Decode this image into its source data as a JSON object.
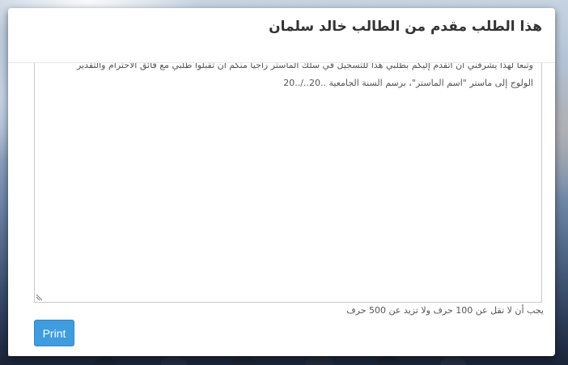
{
  "modal": {
    "title": "هذا الطلب مقدم من الطالب خالد سلمان"
  },
  "letter": {
    "line_partial": "وتبعا لهذا يشرفني أن أتقدم إليكم بطلبي هذا للتسجيل في سلك الماستر راجيا منكم أن تقبلوا طلبي مع فائق الاحترام والتقدير",
    "line_last": "الولوج إلى ماستر \"اسم الماستر\"، برسم السنة الجامعية ..20../..20"
  },
  "form": {
    "help_text": "يجب أن لا تقل عن 100 حرف ولا تزيد عن 500 حرف",
    "print_label": "Print"
  },
  "icons": {
    "scroll_up": "scroll-up-arrow-icon",
    "scroll_down": "scroll-down-arrow-icon",
    "resize": "resize-grip-icon"
  },
  "colors": {
    "primary_button": "#3d9de0",
    "modal_bg": "#ffffff"
  }
}
